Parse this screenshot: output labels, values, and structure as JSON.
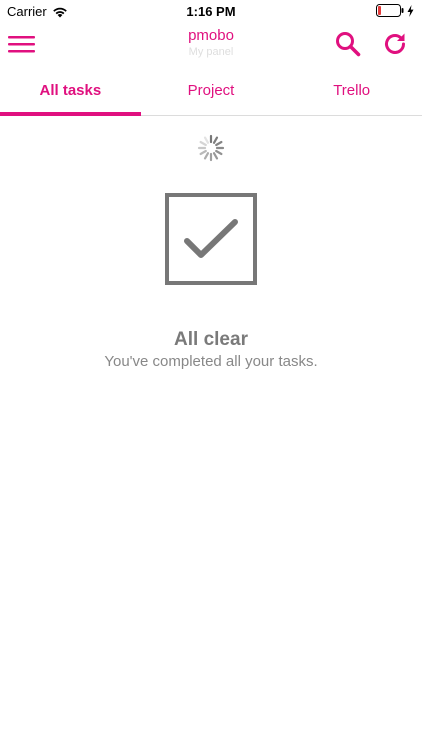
{
  "status_bar": {
    "carrier": "Carrier",
    "time": "1:16 PM",
    "battery_level": 0.12
  },
  "nav": {
    "title": "pmobo",
    "subtitle": "My panel",
    "menu_icon": "hamburger-menu-icon",
    "search_icon": "search-icon",
    "refresh_icon": "refresh-icon"
  },
  "tabs": [
    {
      "label": "All tasks",
      "active": true
    },
    {
      "label": "Project",
      "active": false
    },
    {
      "label": "Trello",
      "active": false
    }
  ],
  "empty_state": {
    "icon": "checkmark-box-icon",
    "title": "All clear",
    "subtitle": "You've completed all your tasks."
  },
  "colors": {
    "accent": "#e0107f",
    "icon_gray": "#777777",
    "text_gray": "#7a7a7a",
    "battery_low": "#e33b3b"
  }
}
